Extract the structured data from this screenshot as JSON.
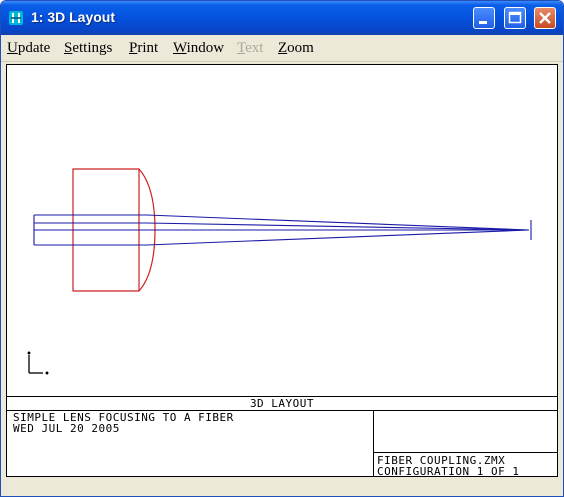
{
  "window": {
    "title": "1: 3D Layout",
    "accent_color": "#0452dd"
  },
  "menu": {
    "items": [
      {
        "label": "Update",
        "accel": "U",
        "rest": "pdate",
        "enabled": true
      },
      {
        "label": "Settings",
        "accel": "S",
        "rest": "ettings",
        "enabled": true
      },
      {
        "label": "Print",
        "accel": "P",
        "rest": "rint",
        "enabled": true
      },
      {
        "label": "Window",
        "accel": "W",
        "rest": "indow",
        "enabled": true
      },
      {
        "label": "Text",
        "accel": "T",
        "rest": "ext",
        "enabled": false
      },
      {
        "label": "Zoom",
        "accel": "Z",
        "rest": "oom",
        "enabled": true
      }
    ]
  },
  "drawing": {
    "lens_color": "#cc2020",
    "ray_color": "#1a1aa8"
  },
  "title_block": {
    "caption": "3D LAYOUT",
    "description_line1": "SIMPLE LENS FOCUSING TO A FIBER",
    "description_line2": "WED JUL 20 2005",
    "file_name": "FIBER COUPLING.ZMX",
    "configuration": "CONFIGURATION 1 OF 1"
  }
}
